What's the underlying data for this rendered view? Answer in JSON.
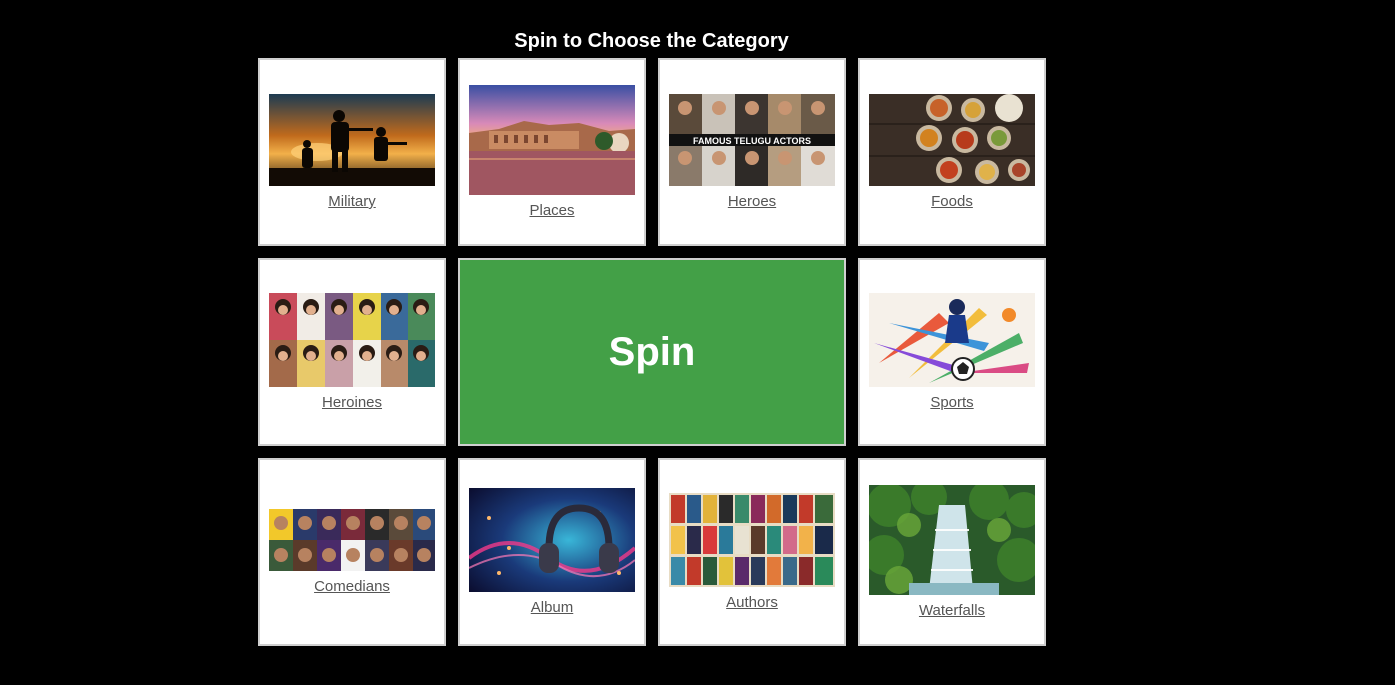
{
  "page": {
    "title": "Spin to Choose the Category"
  },
  "categories": [
    {
      "label": "Military",
      "icon": "military-image"
    },
    {
      "label": "Places",
      "icon": "places-image"
    },
    {
      "label": "Heroes",
      "icon": "heroes-image",
      "banner_text": "FAMOUS TELUGU ACTORS"
    },
    {
      "label": "Foods",
      "icon": "foods-image"
    },
    {
      "label": "Heroines",
      "icon": "heroines-image"
    },
    {
      "label": "Sports",
      "icon": "sports-image"
    },
    {
      "label": "Comedians",
      "icon": "comedians-image"
    },
    {
      "label": "Album",
      "icon": "album-image"
    },
    {
      "label": "Authors",
      "icon": "authors-image"
    },
    {
      "label": "Waterfalls",
      "icon": "waterfalls-image"
    }
  ],
  "spin_button": {
    "label": "Spin",
    "color": "#43a047"
  }
}
